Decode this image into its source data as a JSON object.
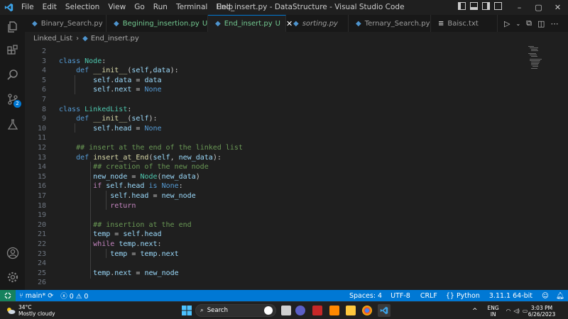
{
  "titlebar": {
    "menu": [
      "File",
      "Edit",
      "Selection",
      "View",
      "Go",
      "Run",
      "Terminal",
      "Help"
    ],
    "window_title": "End_insert.py - DataStructure - Visual Studio Code",
    "controls": {
      "minimize": "–",
      "maximize": "▢",
      "close": "✕"
    }
  },
  "tabs": [
    {
      "name": "Binary_Search.py",
      "icon": "python-file-icon",
      "active": false,
      "modified": ""
    },
    {
      "name": "Begining_insertion.py",
      "icon": "python-file-icon",
      "active": false,
      "modified": "U"
    },
    {
      "name": "End_insert.py",
      "icon": "python-file-icon",
      "active": true,
      "modified": "U"
    },
    {
      "name": "sorting.py",
      "icon": "python-file-icon",
      "active": false,
      "modified": ""
    },
    {
      "name": "Ternary_Search.py",
      "icon": "python-file-icon",
      "active": false,
      "modified": ""
    },
    {
      "name": "Baisc.txt",
      "icon": "text-file-icon",
      "active": false,
      "modified": ""
    }
  ],
  "breadcrumb": {
    "folder": "Linked_List",
    "file": "End_insert.py"
  },
  "editor": {
    "line_numbers": [
      "2",
      "3",
      "4",
      "5",
      "6",
      "7",
      "8",
      "9",
      "10",
      "11",
      "12",
      "13",
      "14",
      "15",
      "16",
      "17",
      "18",
      "19",
      "20",
      "21",
      "22",
      "23",
      "24",
      "25",
      "26"
    ]
  },
  "statusbar": {
    "branch": "main*",
    "errors": "0",
    "warnings": "0",
    "spaces": "Spaces: 4",
    "encoding": "UTF-8",
    "eol": "CRLF",
    "language": "Python",
    "interpreter": "3.11.1 64-bit",
    "source_control_badge": "2"
  },
  "taskbar": {
    "weather_temp": "34°C",
    "weather_desc": "Mostly cloudy",
    "search_placeholder": "Search",
    "lang_line1": "ENG",
    "lang_line2": "IN",
    "time": "3:03 PM",
    "date": "6/26/2023",
    "tray_chevron": "^"
  },
  "colors": {
    "accent": "#0078d4",
    "keyword": "#569cd6",
    "control_keyword": "#c586c0",
    "class": "#4ec9b0",
    "function": "#dcdcaa",
    "variable": "#9cdcfe",
    "comment": "#6a9955",
    "untracked": "#73c991"
  }
}
